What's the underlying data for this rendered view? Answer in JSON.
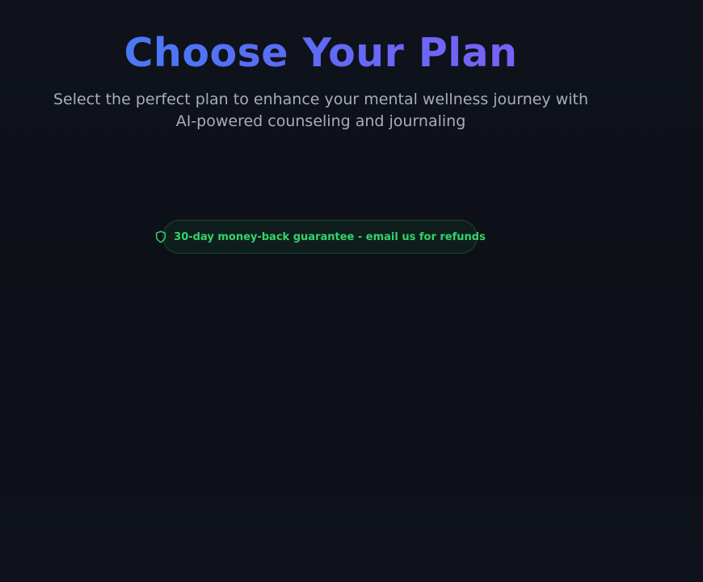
{
  "hero": {
    "title": "Choose Your Plan",
    "subtitle": "Select the perfect plan to enhance your mental wellness journey with AI-powered counseling and journaling"
  },
  "guarantee": {
    "icon": "shield-icon",
    "text": "30-day money-back guarantee - email us for refunds",
    "accent": "#22c55e"
  },
  "colors": {
    "background": "#0e1119",
    "title_gradient_start": "#3b82f6",
    "title_gradient_end": "#8b5cf6",
    "subtitle": "#a7adbb"
  }
}
